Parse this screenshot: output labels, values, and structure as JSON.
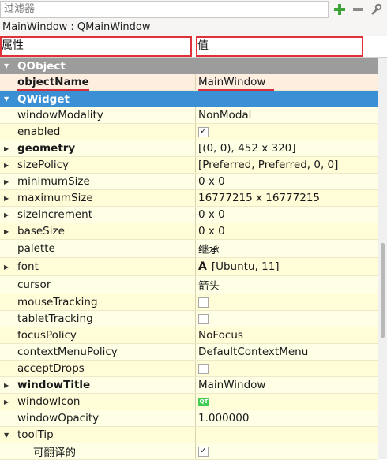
{
  "filter": {
    "placeholder": "过滤器"
  },
  "toolbar": {
    "add": "+",
    "remove": "−"
  },
  "class_line": "MainWindow : QMainWindow",
  "header": {
    "property": "属性",
    "value": "值"
  },
  "rows": [
    {
      "name": "QObject",
      "value": "",
      "kind": "group-gray",
      "arrow": "▼"
    },
    {
      "name": "objectName",
      "value": "MainWindow",
      "kind": "prop",
      "bold": true
    },
    {
      "name": "QWidget",
      "value": "",
      "kind": "group-blue",
      "arrow": "▼"
    },
    {
      "name": "windowModality",
      "value": "NonModal",
      "kind": "prop"
    },
    {
      "name": "enabled",
      "value": "",
      "check": "checked",
      "kind": "prop"
    },
    {
      "name": "geometry",
      "value": "[(0, 0), 452 x 320]",
      "kind": "prop",
      "bold": true,
      "arrow": "▶"
    },
    {
      "name": "sizePolicy",
      "value": "[Preferred, Preferred, 0, 0]",
      "kind": "prop",
      "arrow": "▶"
    },
    {
      "name": "minimumSize",
      "value": "0 x 0",
      "kind": "prop",
      "arrow": "▶"
    },
    {
      "name": "maximumSize",
      "value": "16777215 x 16777215",
      "kind": "prop",
      "arrow": "▶"
    },
    {
      "name": "sizeIncrement",
      "value": "0 x 0",
      "kind": "prop",
      "arrow": "▶"
    },
    {
      "name": "baseSize",
      "value": "0 x 0",
      "kind": "prop",
      "arrow": "▶"
    },
    {
      "name": "palette",
      "value": "继承",
      "kind": "prop",
      "tall": true
    },
    {
      "name": "font",
      "value": "[Ubuntu, 11]",
      "font_glyph": "A",
      "kind": "prop",
      "arrow": "▶",
      "tall": true
    },
    {
      "name": "cursor",
      "value": "箭头",
      "kind": "prop",
      "tall": true
    },
    {
      "name": "mouseTracking",
      "value": "",
      "check": "unchecked",
      "kind": "prop"
    },
    {
      "name": "tabletTracking",
      "value": "",
      "check": "unchecked",
      "kind": "prop"
    },
    {
      "name": "focusPolicy",
      "value": "NoFocus",
      "kind": "prop"
    },
    {
      "name": "contextMenuPolicy",
      "value": "DefaultContextMenu",
      "kind": "prop"
    },
    {
      "name": "acceptDrops",
      "value": "",
      "check": "unchecked",
      "kind": "prop"
    },
    {
      "name": "windowTitle",
      "value": "MainWindow",
      "kind": "prop",
      "bold": true,
      "arrow": "▶"
    },
    {
      "name": "windowIcon",
      "value": "",
      "icon": "qt-icon",
      "icon_text": "QT",
      "kind": "prop",
      "arrow": "▶"
    },
    {
      "name": "windowOpacity",
      "value": "1.000000",
      "kind": "prop"
    },
    {
      "name": "toolTip",
      "value": "",
      "kind": "prop",
      "arrow": "▼"
    },
    {
      "name": "可翻译的",
      "value": "",
      "check": "checked",
      "kind": "sub"
    }
  ],
  "colors": {
    "group_gray": "#9c9c9c",
    "group_blue": "#3b8fd4",
    "row_yellow": "#ffffe6",
    "highlight_red": "#e0303a",
    "qt_green": "#41cd52"
  }
}
